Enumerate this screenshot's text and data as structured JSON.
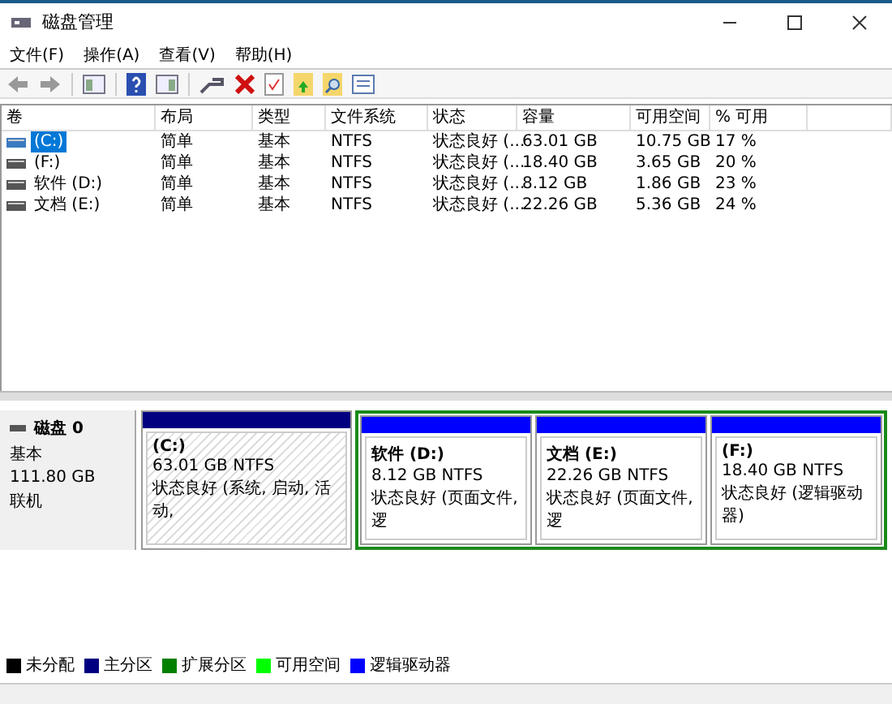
{
  "window": {
    "title": "磁盘管理"
  },
  "menu": [
    "文件(F)",
    "操作(A)",
    "查看(V)",
    "帮助(H)"
  ],
  "table": {
    "columns": [
      "卷",
      "布局",
      "类型",
      "文件系统",
      "状态",
      "容量",
      "可用空间",
      "% 可用"
    ],
    "rows": [
      {
        "selected": true,
        "cells": [
          "(C:)",
          "简单",
          "基本",
          "NTFS",
          "状态良好 (...",
          "63.01 GB",
          "10.75 GB",
          "17 %"
        ]
      },
      {
        "selected": false,
        "cells": [
          "(F:)",
          "简单",
          "基本",
          "NTFS",
          "状态良好 (...",
          "18.40 GB",
          "3.65 GB",
          "20 %"
        ]
      },
      {
        "selected": false,
        "cells": [
          "软件 (D:)",
          "简单",
          "基本",
          "NTFS",
          "状态良好 (...",
          "8.12 GB",
          "1.86 GB",
          "23 %"
        ]
      },
      {
        "selected": false,
        "cells": [
          "文档 (E:)",
          "简单",
          "基本",
          "NTFS",
          "状态良好 (...",
          "22.26 GB",
          "5.36 GB",
          "24 %"
        ]
      }
    ]
  },
  "disk": {
    "name": "磁盘 0",
    "type": "基本",
    "size": "111.80 GB",
    "status": "联机",
    "partitions": [
      {
        "kind": "primary",
        "selected": true,
        "name": "(C:)",
        "size": "63.01 GB NTFS",
        "status": "状态良好 (系统, 启动, 活动,"
      },
      {
        "kind": "logical",
        "selected": false,
        "name": "软件  (D:)",
        "size": "8.12 GB NTFS",
        "status": "状态良好 (页面文件, 逻"
      },
      {
        "kind": "logical",
        "selected": false,
        "name": "文档  (E:)",
        "size": "22.26 GB NTFS",
        "status": "状态良好 (页面文件, 逻"
      },
      {
        "kind": "logical",
        "selected": false,
        "name": "(F:)",
        "size": "18.40 GB NTFS",
        "status": "状态良好 (逻辑驱动器)"
      }
    ]
  },
  "legend": [
    {
      "label": "未分配",
      "color": "#000000"
    },
    {
      "label": "主分区",
      "color": "#000080"
    },
    {
      "label": "扩展分区",
      "color": "#008000"
    },
    {
      "label": "可用空间",
      "color": "#00ff00"
    },
    {
      "label": "逻辑驱动器",
      "color": "#0000ff"
    }
  ]
}
